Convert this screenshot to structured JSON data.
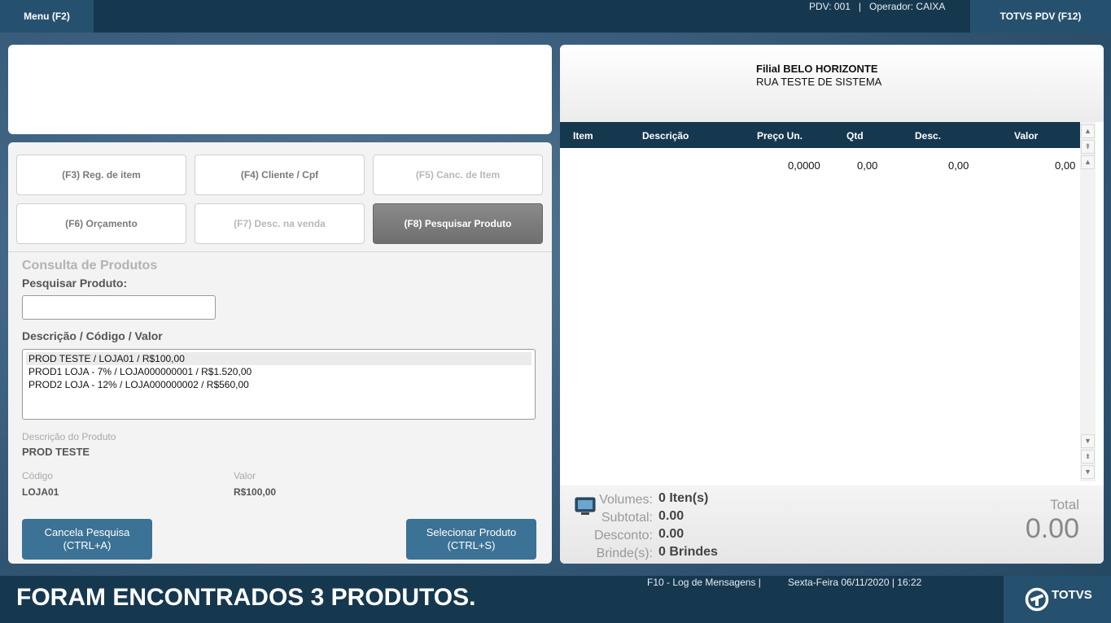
{
  "topbar": {
    "menu_label": "Menu (F2)",
    "pdv_info": "PDV: 001   |   Operador: CAIXA",
    "totvs_label": "TOTVS PDV (F12)"
  },
  "actions": {
    "f3": "(F3) Reg. de item",
    "f4": "(F4) Cliente / Cpf",
    "f5": "(F5) Canc. de Item",
    "f6": "(F6) Orçamento",
    "f7": "(F7) Desc. na venda",
    "f8": "(F8) Pesquisar Produto"
  },
  "consulta": {
    "title": "Consulta de Produtos",
    "search_label": "Pesquisar Produto:",
    "search_value": "",
    "list_label": "Descrição / Código / Valor",
    "items": [
      "PROD TESTE / LOJA01 / R$100,00",
      "PROD1 LOJA - 7% / LOJA000000001 / R$1.520,00",
      "PROD2 LOJA - 12% / LOJA000000002 / R$560,00"
    ],
    "desc_label": "Descrição do Produto",
    "desc_value": "PROD TESTE",
    "code_label": "Código",
    "code_value": "LOJA01",
    "value_label": "Valor",
    "value_value": "R$100,00",
    "cancel_line1": "Cancela Pesquisa",
    "cancel_line2": "(CTRL+A)",
    "select_line1": "Selecionar Produto",
    "select_line2": "(CTRL+S)"
  },
  "receipt": {
    "filial": "Filial BELO HORIZONTE",
    "address": "RUA TESTE DE SISTEMA",
    "columns": [
      "Item",
      "Descrição",
      "Preço Un.",
      "Qtd",
      "Desc.",
      "Valor"
    ],
    "row": {
      "preco": "0,0000",
      "qtd": "0,00",
      "desc": "0,00",
      "valor": "0,00"
    }
  },
  "summary": {
    "volumes_label": "Volumes:",
    "volumes_value": "0 Iten(s)",
    "subtotal_label": "Subtotal:",
    "subtotal_value": "0.00",
    "desconto_label": "Desconto:",
    "desconto_value": "0.00",
    "brindes_label": "Brinde(s):",
    "brindes_value": "0 Brindes",
    "total_label": "Total",
    "total_value": "0.00"
  },
  "status": {
    "message": "FORAM ENCONTRADOS 3 PRODUTOS.",
    "f10": "F10 - Log de Mensagens |",
    "datetime": "Sexta-Feira 06/11/2020 | 16:22",
    "logo": "TOTVS"
  }
}
